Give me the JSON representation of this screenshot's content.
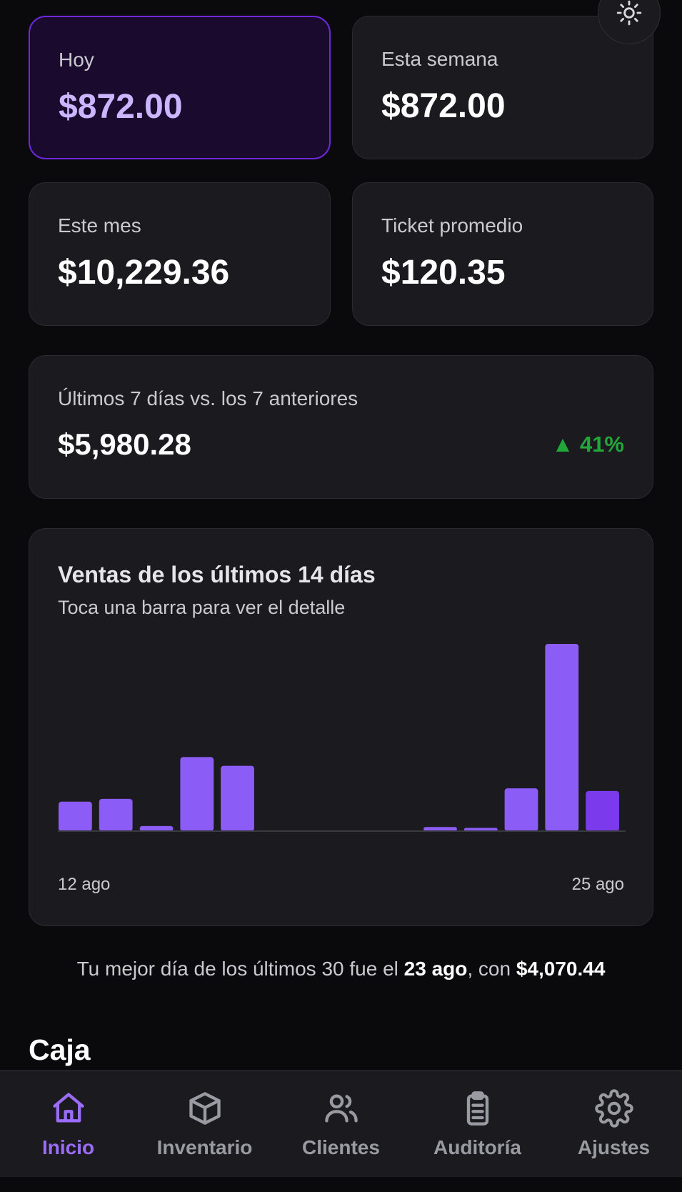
{
  "stats": [
    {
      "label": "Hoy",
      "value": "$872.00"
    },
    {
      "label": "Esta semana",
      "value": "$872.00"
    },
    {
      "label": "Este mes",
      "value": "$10,229.36"
    },
    {
      "label": "Ticket promedio",
      "value": "$120.35"
    }
  ],
  "comparison": {
    "label": "Últimos 7 días vs. los 7 anteriores",
    "value": "$5,980.28",
    "change": "▲ 41%"
  },
  "chart": {
    "title": "Ventas de los últimos 14 días",
    "subtitle": "Toca una barra para ver el detalle",
    "start_label": "12 ago",
    "end_label": "25 ago"
  },
  "chart_data": {
    "type": "bar",
    "title": "Ventas de los últimos 14 días",
    "x_start": "12 ago",
    "x_end": "25 ago",
    "values": [
      640,
      700,
      110,
      1610,
      1420,
      0,
      0,
      0,
      0,
      90,
      70,
      930,
      4070.44,
      872
    ],
    "highlight_index": 13,
    "ylim": [
      0,
      4070.44
    ],
    "colors": {
      "bar": "#8b5cf6",
      "highlight": "#7c3aed",
      "baseline": "#3a3a42"
    }
  },
  "best_day": {
    "prefix": "Tu mejor día de los últimos 30 fue el ",
    "date": "23 ago",
    "middle": ", con ",
    "amount": "$4,070.44"
  },
  "section": {
    "caja": "Caja"
  },
  "nav": {
    "items": [
      {
        "label": "Inicio",
        "icon": "home-icon",
        "active": true
      },
      {
        "label": "Inventario",
        "icon": "box-icon",
        "active": false
      },
      {
        "label": "Clientes",
        "icon": "users-icon",
        "active": false
      },
      {
        "label": "Auditoría",
        "icon": "clipboard-icon",
        "active": false
      },
      {
        "label": "Ajustes",
        "icon": "gear-icon",
        "active": false
      }
    ]
  },
  "colors": {
    "accent": "#8b5cf6",
    "positive": "#22a83a",
    "background": "#0a0a0c",
    "card": "#1b1b1f"
  }
}
